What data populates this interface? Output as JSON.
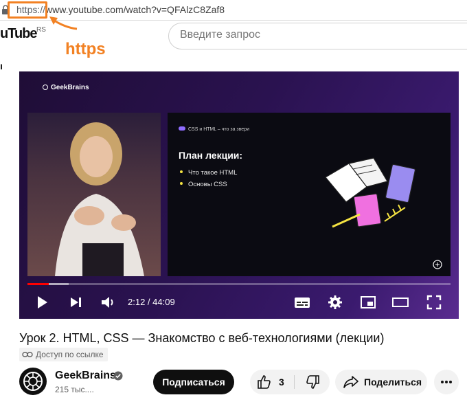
{
  "browser": {
    "url_scheme": "https://",
    "url_rest": "www.youtube.com/watch?v=QFAlzC8Zaf8",
    "annotation_label": "https",
    "annotation_color": "#f28123"
  },
  "youtube_header": {
    "logo_text": "uTube",
    "logo_region": "RS",
    "side_fragment": "ı",
    "search_placeholder": "Введите запрос"
  },
  "player": {
    "brand_label": "GeekBrains",
    "slide": {
      "crumb": "CSS и HTML – что за звери",
      "title": "План лекции:",
      "items": [
        "Что такое HTML",
        "Основы CSS"
      ]
    },
    "time_current": "2:12",
    "time_separator": " / ",
    "time_total": "44:09",
    "progress_fraction": 0.05,
    "controls": [
      "play-icon",
      "next-icon",
      "volume-icon",
      "subtitles-icon",
      "settings-icon",
      "miniplayer-icon",
      "theater-icon",
      "fullscreen-icon"
    ]
  },
  "video": {
    "title": "Урок 2. HTML, CSS — Знакомство с веб-технологиями (лекции)",
    "access_label": "Доступ по ссылке"
  },
  "channel": {
    "name": "GeekBrains",
    "subscribers": "215 тыс....",
    "subscribe_label": "Подписаться"
  },
  "actions": {
    "likes": "3",
    "share_label": "Поделиться"
  },
  "colors": {
    "progress_red": "#ff0000",
    "accent_orange": "#f28123"
  }
}
